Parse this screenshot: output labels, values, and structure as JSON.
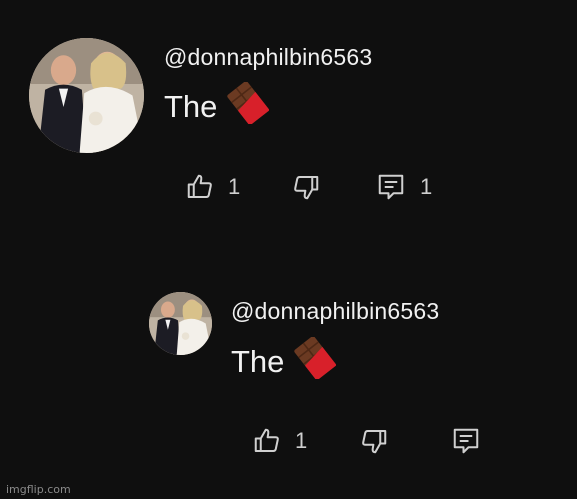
{
  "comments": [
    {
      "author": "@donnaphilbin6563",
      "text": "The",
      "emoji": "chocolate-bar-emoji",
      "likes": "1",
      "replies": "1",
      "icons": [
        "thumbs-up-icon",
        "thumbs-down-icon",
        "reply-icon"
      ]
    },
    {
      "author": "@donnaphilbin6563",
      "text": "The",
      "emoji": "chocolate-bar-emoji",
      "likes": "1",
      "replies": "",
      "icons": [
        "thumbs-up-icon",
        "thumbs-down-icon",
        "reply-icon"
      ]
    }
  ],
  "watermark": "imgflip.com",
  "colors": {
    "background": "#0f0f0f",
    "text": "#f1f1f1",
    "icon": "#d0d0d0",
    "chocolate": "#6b3a22",
    "wrapper": "#d8202a"
  }
}
